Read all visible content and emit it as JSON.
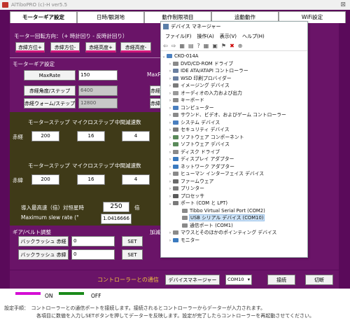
{
  "app": {
    "title": "AlTiboPRO (c)-H ver5.5",
    "close_glyph": "⊠"
  },
  "tabs": [
    {
      "label": "モーターギア設定",
      "active": true
    },
    {
      "label": "日時/観測地",
      "active": false
    },
    {
      "label": "動作制限項目",
      "active": false
    },
    {
      "label": "追動動作",
      "active": false
    },
    {
      "label": "WiFi設定",
      "active": false
    }
  ],
  "motor": {
    "rotation_label": "モーター回転方向：（+ 時計回り - 反時計回り）",
    "dir_buttons": [
      "赤緯方位+",
      "赤緯方位-",
      "赤経高度+",
      "赤経高度-"
    ],
    "gear_label": "モーターギア設定",
    "maxrate_label": "MaxRate",
    "maxrate_value": "150",
    "maxrate_right": "MaxR",
    "dec_step_label": "赤経角度/ステップ",
    "dec_step_value": "6400",
    "dec_step_right": "赤経",
    "worm_label": "赤経ウォーム/ステップ",
    "worm_value": "12800",
    "worm_right": "赤緯"
  },
  "gear_ra": {
    "headers": [
      "モーターステップ",
      "マイクロステップ",
      "中間減速数"
    ],
    "row_label": "赤経",
    "values": [
      "200",
      "16",
      "4"
    ]
  },
  "gear_dec": {
    "headers": [
      "モーターステップ",
      "マイクロステップ",
      "中間減速数"
    ],
    "row_label": "赤緯",
    "values": [
      "200",
      "16",
      "4"
    ]
  },
  "slew": {
    "guide_label": "導入最高速（倍）対恒星時",
    "guide_value": "250",
    "guide_unit": "倍",
    "max_label": "Maximum slew rate (°",
    "max_value": "1.0416666"
  },
  "backlash": {
    "section_label": "ギア/ベルト調整",
    "right_label": "加減",
    "rows": [
      {
        "label": "バックラッシュ 赤経",
        "value": "0",
        "set": "SET"
      },
      {
        "label": "バックラッシュ 赤緯",
        "value": "0",
        "set": "SET"
      }
    ]
  },
  "bottom": {
    "comm_label": "コントローラーとの通信",
    "devmgr_button": "デバイスマネージャー",
    "com_value": "COM10",
    "connect_button": "接続",
    "disconnect_button": "切断"
  },
  "legend": {
    "on_label": "ON",
    "off_label": "OFF",
    "on_color": "#d40ed4",
    "off_color": "#1a8a1a"
  },
  "footer": {
    "line1": "設定手順：　コントローラーとの通信ポートを接続します。接続されるとコントローラーからデーターが入力されます。",
    "line2": "各項目に数値を入力しSETボタンを押してデーターを反映します。設定が完了したらコントローラーを再起動させてください。"
  },
  "device_manager": {
    "title": "デバイス マネージャー",
    "menu": [
      "ファイル(F)",
      "操作(A)",
      "表示(V)",
      "ヘルプ(H)"
    ],
    "toolbar": [
      "⇦",
      "⇨",
      "▦",
      "▤",
      "?",
      "▦",
      "▣",
      "⚑",
      "✖",
      "⊕"
    ],
    "root": "CKO-014A",
    "items": [
      {
        "label": "DVD/CD-ROM ドライブ",
        "level": 1,
        "icon": "#8a8a8a",
        "expanded": false
      },
      {
        "label": "IDE ATA/ATAPI コントローラー",
        "level": 1,
        "icon": "#6a7fa0",
        "expanded": false
      },
      {
        "label": "WSD 印刷プロバイダー",
        "level": 1,
        "icon": "#6a7fa0",
        "expanded": false
      },
      {
        "label": "イメージング デバイス",
        "level": 1,
        "icon": "#7a7a7a",
        "expanded": false
      },
      {
        "label": "オーディオの入力および出力",
        "level": 1,
        "icon": "#9a9a9a",
        "expanded": false
      },
      {
        "label": "キーボード",
        "level": 1,
        "icon": "#8a8a8a",
        "expanded": false
      },
      {
        "label": "コンピューター",
        "level": 1,
        "icon": "#4a7fbf",
        "expanded": false
      },
      {
        "label": "サウンド、ビデオ、およびゲーム コントローラー",
        "level": 1,
        "icon": "#8a8a8a",
        "expanded": false
      },
      {
        "label": "システム デバイス",
        "level": 1,
        "icon": "#4a7fbf",
        "expanded": false
      },
      {
        "label": "セキュリティ デバイス",
        "level": 1,
        "icon": "#7a7a7a",
        "expanded": false
      },
      {
        "label": "ソフトウェア コンポーネント",
        "level": 1,
        "icon": "#5a8a5a",
        "expanded": false
      },
      {
        "label": "ソフトウェア デバイス",
        "level": 1,
        "icon": "#5a8a5a",
        "expanded": false
      },
      {
        "label": "ディスク ドライブ",
        "level": 1,
        "icon": "#8a8a8a",
        "expanded": false
      },
      {
        "label": "ディスプレイ アダプター",
        "level": 1,
        "icon": "#3a7abf",
        "expanded": false
      },
      {
        "label": "ネットワーク アダプター",
        "level": 1,
        "icon": "#3a7abf",
        "expanded": false
      },
      {
        "label": "ヒューマン インターフェイス デバイス",
        "level": 1,
        "icon": "#8a8a8a",
        "expanded": false
      },
      {
        "label": "ファームウェア",
        "level": 1,
        "icon": "#6a6a6a",
        "expanded": false
      },
      {
        "label": "プリンター",
        "level": 1,
        "icon": "#7a7a7a",
        "expanded": false
      },
      {
        "label": "プロセッサ",
        "level": 1,
        "icon": "#5a5a5a",
        "expanded": false
      },
      {
        "label": "ポート (COM と LPT)",
        "level": 1,
        "icon": "#7a7a7a",
        "expanded": true
      },
      {
        "label": "Tibbo Virtual Serial Port (COM2)",
        "level": 2,
        "icon": "#8a8a8a",
        "expanded": null
      },
      {
        "label": "USB シリアル デバイス (COM10)",
        "level": 2,
        "icon": "#8a8a8a",
        "expanded": null,
        "highlight": true
      },
      {
        "label": "通信ポート (COM1)",
        "level": 2,
        "icon": "#8a8a8a",
        "expanded": null
      },
      {
        "label": "マウスとそのほかのポインティング デバイス",
        "level": 1,
        "icon": "#8a8a8a",
        "expanded": false
      },
      {
        "label": "モニター",
        "level": 1,
        "icon": "#3a7abf",
        "expanded": false
      }
    ]
  }
}
